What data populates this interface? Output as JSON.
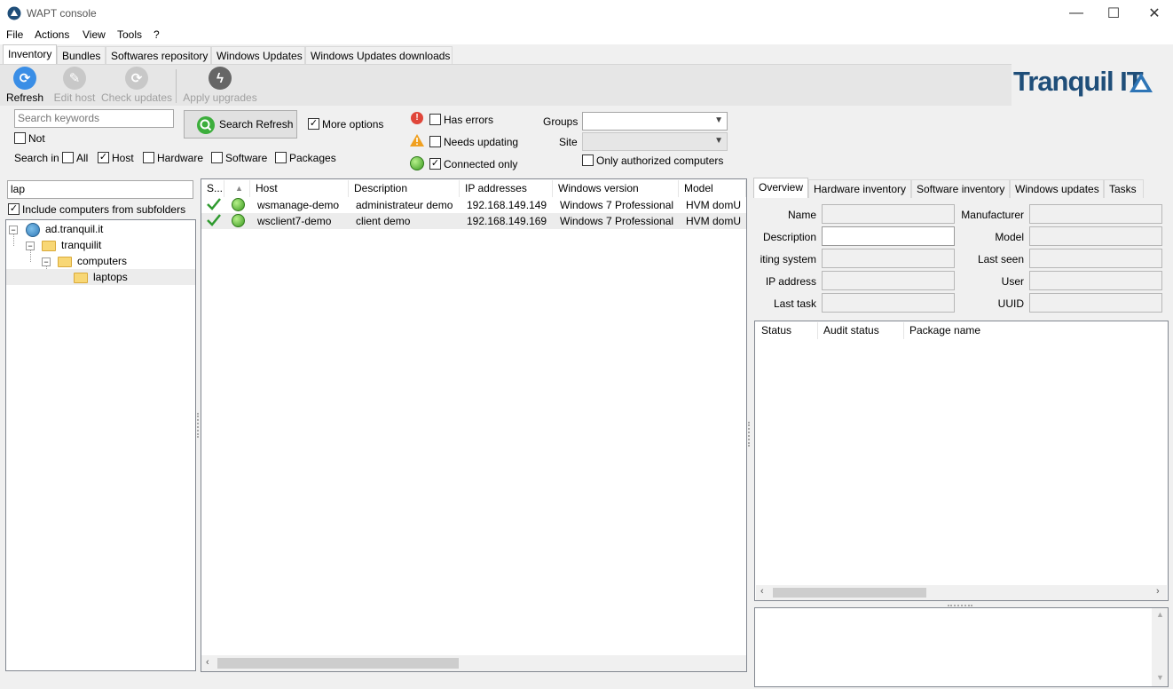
{
  "window": {
    "title": "WAPT console",
    "minimize": "—",
    "maximize": "☐",
    "close": "✕"
  },
  "menu": [
    "File",
    "Actions",
    "View",
    "Tools",
    "?"
  ],
  "tabs": [
    "Inventory",
    "Bundles",
    "Softwares repository",
    "Windows Updates",
    "Windows Updates downloads"
  ],
  "toolbar": {
    "refresh": "Refresh",
    "edit_host": "Edit host",
    "check_updates": "Check updates",
    "apply_upgrades": "Apply upgrades"
  },
  "logo": {
    "text": "Tranquil IT"
  },
  "search": {
    "placeholder": "Search keywords",
    "not_label": "Not",
    "search_in_label": "Search in",
    "button": "Search Refresh",
    "more_options": "More options",
    "search_in": {
      "all": {
        "label": "All",
        "checked": false
      },
      "host": {
        "label": "Host",
        "checked": true
      },
      "hardware": {
        "label": "Hardware",
        "checked": false
      },
      "software": {
        "label": "Software",
        "checked": false
      },
      "packages": {
        "label": "Packages",
        "checked": false
      }
    }
  },
  "filters": {
    "has_errors": "Has errors",
    "needs_updating": "Needs updating",
    "connected_only": "Connected only",
    "groups_label": "Groups",
    "site_label": "Site",
    "only_authorized": "Only authorized computers",
    "groups_value": "",
    "site_value": ""
  },
  "tree": {
    "filter_value": "lap",
    "include_subfolders": "Include computers from  subfolders",
    "root": "ad.tranquil.it",
    "n1": "tranquilit",
    "n2": "computers",
    "n3": "laptops"
  },
  "hosts": {
    "columns": {
      "status": "S...",
      "sort": "▲",
      "host": "Host",
      "description": "Description",
      "ip": "IP addresses",
      "winver": "Windows version",
      "model": "Model"
    },
    "rows": [
      {
        "host": "wsmanage-demo",
        "description": "administrateur demo",
        "ip": "192.168.149.149",
        "winver": "Windows 7 Professional",
        "model": "HVM domU"
      },
      {
        "host": "wsclient7-demo",
        "description": "client demo",
        "ip": "192.168.149.169",
        "winver": "Windows 7 Professional",
        "model": "HVM domU"
      }
    ]
  },
  "details": {
    "tabs": [
      "Overview",
      "Hardware inventory",
      "Software inventory",
      "Windows updates",
      "Tasks"
    ],
    "fields_left": [
      "Name",
      "Description",
      "iting system",
      "IP address",
      "Last task"
    ],
    "fields_right": [
      "Manufacturer",
      "Model",
      "Last seen",
      "User",
      "UUID"
    ],
    "packages_columns": [
      "Status",
      "Audit status",
      "Package name"
    ]
  },
  "colors": {
    "accent_blue": "#1f4e79",
    "ok_green": "#3cae3c",
    "error_red": "#e0463a",
    "warn_orange": "#f0a020"
  }
}
